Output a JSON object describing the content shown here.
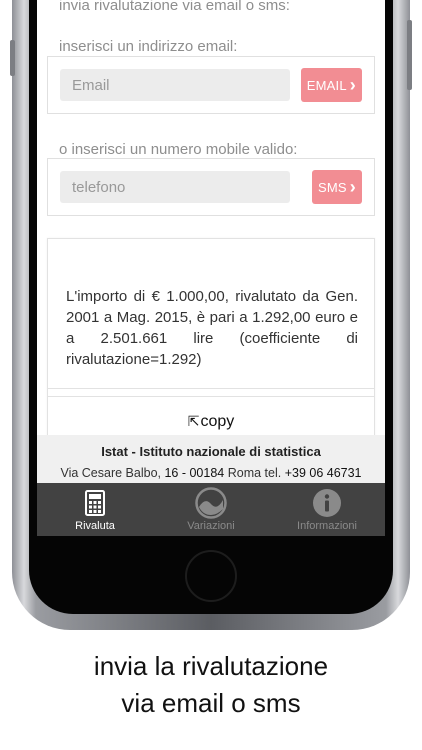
{
  "form": {
    "top_text": "invia rivalutazione via email o sms:",
    "email_label": "inserisci un indirizzo email:",
    "email_placeholder": "Email",
    "email_button": "EMAIL",
    "phone_label": "o inserisci un numero mobile valido:",
    "phone_placeholder": "telefono",
    "sms_button": "SMS"
  },
  "result": {
    "text": "L'importo di € 1.000,00, rivalutato da Gen. 2001 a Mag. 2015, è pari a 1.292,00 euro e a 2.501.661 lire (coefficiente di rivalutazione=1.292)",
    "copy_label": "copy"
  },
  "footer": {
    "title": "Istat - Istituto nazionale di statistica",
    "address_1": "Via Cesare Balbo, ",
    "address_2": "16 - 00184",
    "address_3": " Roma tel. ",
    "phone": "+39 06 46731"
  },
  "tabs": [
    {
      "label": "Rivaluta",
      "icon": "calculator-icon",
      "active": true
    },
    {
      "label": "Variazioni",
      "icon": "gauge-icon",
      "active": false
    },
    {
      "label": "Informazioni",
      "icon": "info-icon",
      "active": false
    }
  ],
  "caption": {
    "line1": "invia la rivalutazione",
    "line2": "via email o sms"
  },
  "colors": {
    "button": "#f28d93",
    "tabbar": "#424242",
    "footer_bg": "#f0f0f0"
  }
}
